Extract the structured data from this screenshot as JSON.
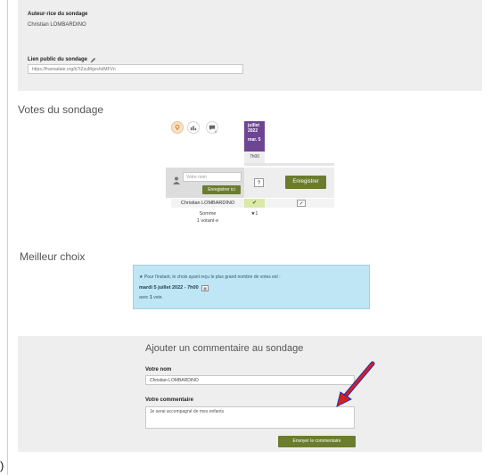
{
  "author": {
    "label": "Auteur·rice du sondage",
    "name": "Christian LOMBARDINO",
    "link_label": "Lien public du sondage",
    "link_value": "https://framadate.org/b7tZsuMgxshdMFVn"
  },
  "votes": {
    "title": "Votes du sondage",
    "view_icons": [
      "lightbulb-icon",
      "chart-icon",
      "comment-icon"
    ],
    "comment_count": "0",
    "date": {
      "month": "juillet",
      "year": "2022",
      "day": "mar. 5"
    },
    "hour": "7h00",
    "name_placeholder": "Votre nom",
    "save_here_label": "Enregistrer ici",
    "save_label": "Enregistrer",
    "unknown_mark": "?",
    "participant_name": "Christian LOMBARDINO",
    "participant_vote": "✔",
    "sum_label": "Somme",
    "voters_label": "1 votant·e",
    "sum_value": "★1"
  },
  "best": {
    "title": "Meilleur choix",
    "intro": "★ Pour l'instant, le choix ayant reçu le plus grand nombre de votes est :",
    "choice": "mardi 5 juillet 2022 - 7h00",
    "votes_prefix": "avec",
    "votes_count": "1",
    "votes_suffix": "vote."
  },
  "comment": {
    "title": "Ajouter un commentaire au sondage",
    "name_label": "Votre nom",
    "name_value": "Christian LOMBARDINO",
    "comment_label": "Votre commentaire",
    "comment_value": "Je serai accompagné de mes enfants",
    "send_label": "Envoyer le commentaire"
  },
  "annotation": {
    "arrow_color": "#d42020",
    "arrow_outline": "#1a2fb0"
  },
  "colors": {
    "accent_purple": "#6d4593",
    "button_green": "#6b7c2f",
    "info_blue": "#bfe6f4"
  }
}
